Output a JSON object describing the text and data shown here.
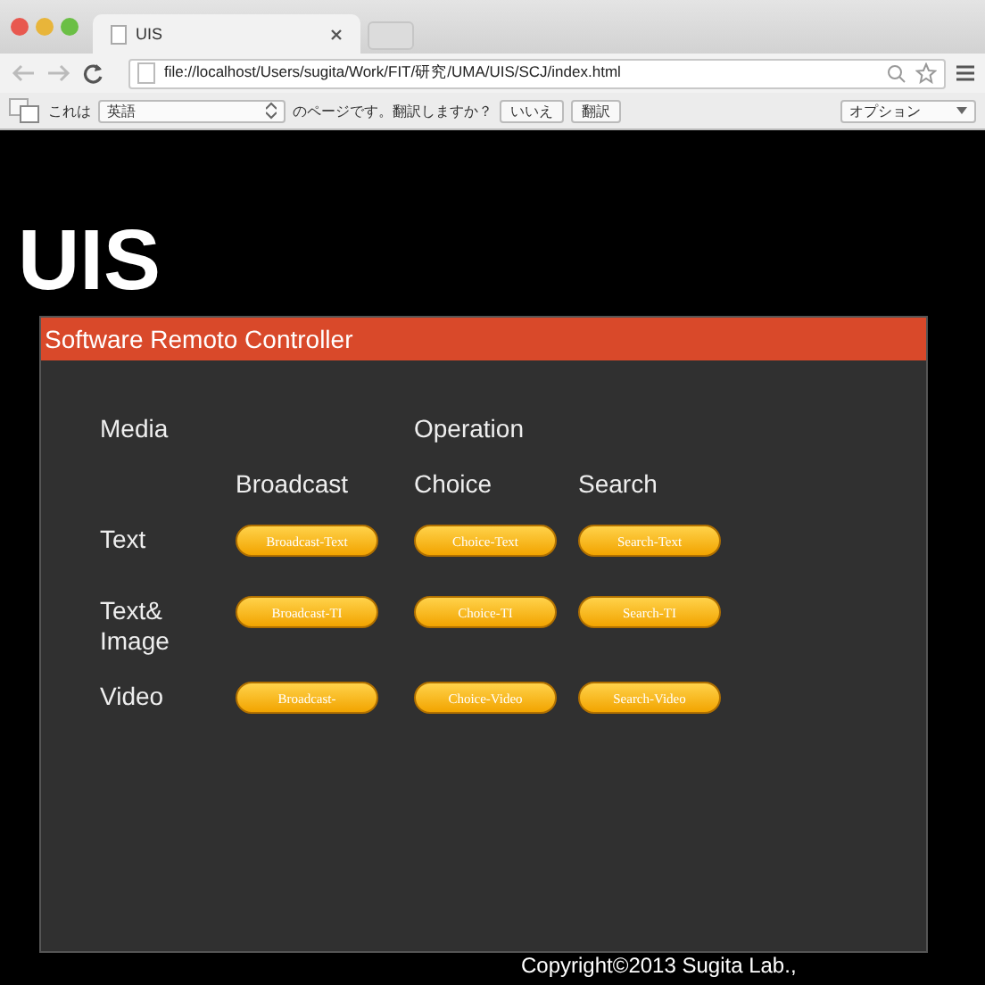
{
  "browser": {
    "tab_title": "UIS",
    "url": "file://localhost/Users/sugita/Work/FIT/研究/UMA/UIS/SCJ/index.html"
  },
  "translate_bar": {
    "prefix": "これは",
    "language": "英語",
    "question": "のページです。翻訳しますか？",
    "decline": "いいえ",
    "translate": "翻訳",
    "options": "オプション"
  },
  "page": {
    "logo": "UIS",
    "panel_title": "Software Remoto Controller",
    "media_label": "Media",
    "operation_label": "Operation",
    "columns": [
      "Broadcast",
      "Choice",
      "Search"
    ],
    "rows": [
      {
        "label": "Text",
        "buttons": [
          "Broadcast-Text",
          "Choice-Text",
          "Search-Text"
        ]
      },
      {
        "label": "Text&\nImage",
        "buttons": [
          "Broadcast-TI",
          "Choice-TI",
          "Search-TI"
        ]
      },
      {
        "label": "Video",
        "buttons": [
          "Broadcast-",
          "Choice-Video",
          "Search-Video"
        ]
      }
    ],
    "copyright": "Copyright©2013 Sugita Lab.,"
  }
}
